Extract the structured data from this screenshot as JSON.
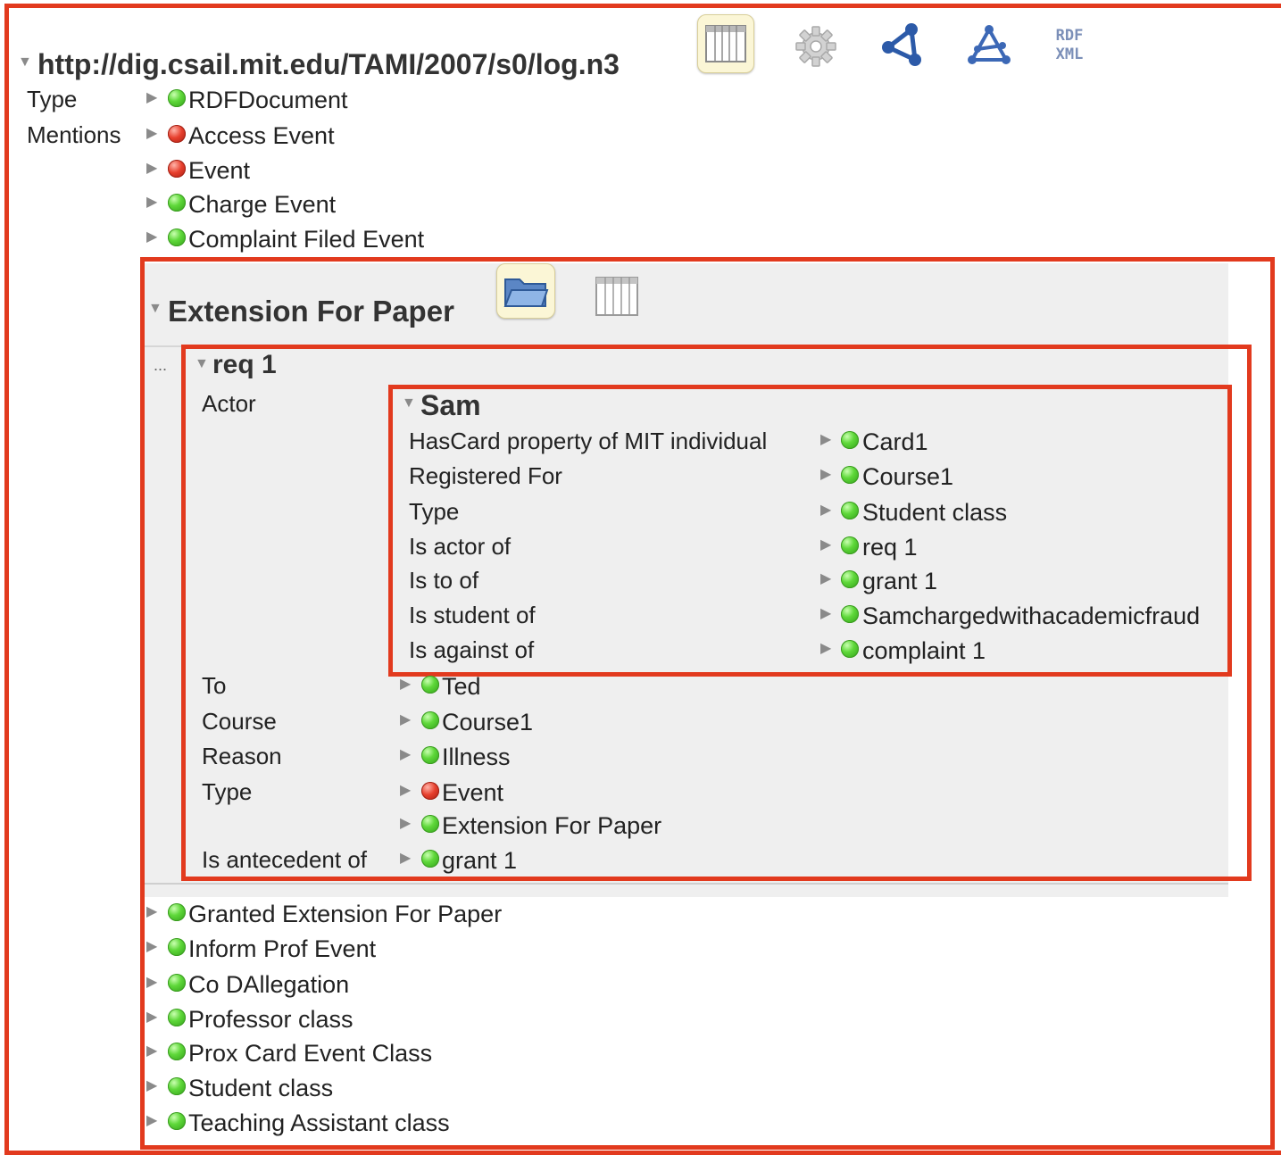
{
  "document": {
    "url": "http://dig.csail.mit.edu/TAMI/2007/s0/log.n3",
    "properties": [
      {
        "label": "Type",
        "values": [
          {
            "text": "RDFDocument",
            "status": "green"
          }
        ]
      },
      {
        "label": "Mentions",
        "values": [
          {
            "text": "Access Event",
            "status": "red"
          },
          {
            "text": "Event",
            "status": "red"
          },
          {
            "text": "Charge Event",
            "status": "green"
          },
          {
            "text": "Complaint Filed Event",
            "status": "green"
          }
        ]
      }
    ],
    "toolbar": [
      "table-view-icon",
      "gear-icon",
      "graph-icon",
      "tabulator-icon",
      "rdf-xml-icon"
    ],
    "rdfxml_label_top": "RDF",
    "rdfxml_label_bottom": "XML"
  },
  "extension_panel": {
    "title": "Extension For Paper",
    "toolbar": [
      "folder-icon",
      "table-view-icon"
    ],
    "ellipsis": "...",
    "req": {
      "title": "req 1",
      "actor_label": "Actor",
      "sam": {
        "title": "Sam",
        "rows": [
          {
            "label": "HasCard property of MIT individual",
            "value": "Card1",
            "status": "green"
          },
          {
            "label": "Registered For",
            "value": "Course1",
            "status": "green"
          },
          {
            "label": "Type",
            "value": "Student class",
            "status": "green"
          },
          {
            "label": "Is actor of",
            "value": "req 1",
            "status": "green"
          },
          {
            "label": "Is to of",
            "value": "grant 1",
            "status": "green"
          },
          {
            "label": "Is student of",
            "value": "Samchargedwithacademicfraud",
            "status": "green"
          },
          {
            "label": "Is against of",
            "value": "complaint 1",
            "status": "green"
          }
        ]
      },
      "rows": [
        {
          "label": "To",
          "value": "Ted",
          "status": "green"
        },
        {
          "label": "Course",
          "value": "Course1",
          "status": "green"
        },
        {
          "label": "Reason",
          "value": "Illness",
          "status": "green"
        },
        {
          "label": "Type",
          "value": "Event",
          "status": "red"
        },
        {
          "label": "",
          "value": "Extension For Paper",
          "status": "green"
        },
        {
          "label": "Is antecedent of",
          "value": "grant 1",
          "status": "green"
        }
      ]
    }
  },
  "mentions_more": [
    {
      "text": "Granted Extension For Paper",
      "status": "green"
    },
    {
      "text": "Inform Prof Event",
      "status": "green"
    },
    {
      "text": "Co DAllegation",
      "status": "green"
    },
    {
      "text": "Professor class",
      "status": "green"
    },
    {
      "text": "Prox Card Event Class",
      "status": "green"
    },
    {
      "text": "Student class",
      "status": "green"
    },
    {
      "text": "Teaching Assistant class",
      "status": "green"
    }
  ],
  "colors": {
    "highlight_border": "#e23a1e",
    "panel_background": "#efefef",
    "status_green": "#4cc52b",
    "status_red": "#d9362a"
  }
}
